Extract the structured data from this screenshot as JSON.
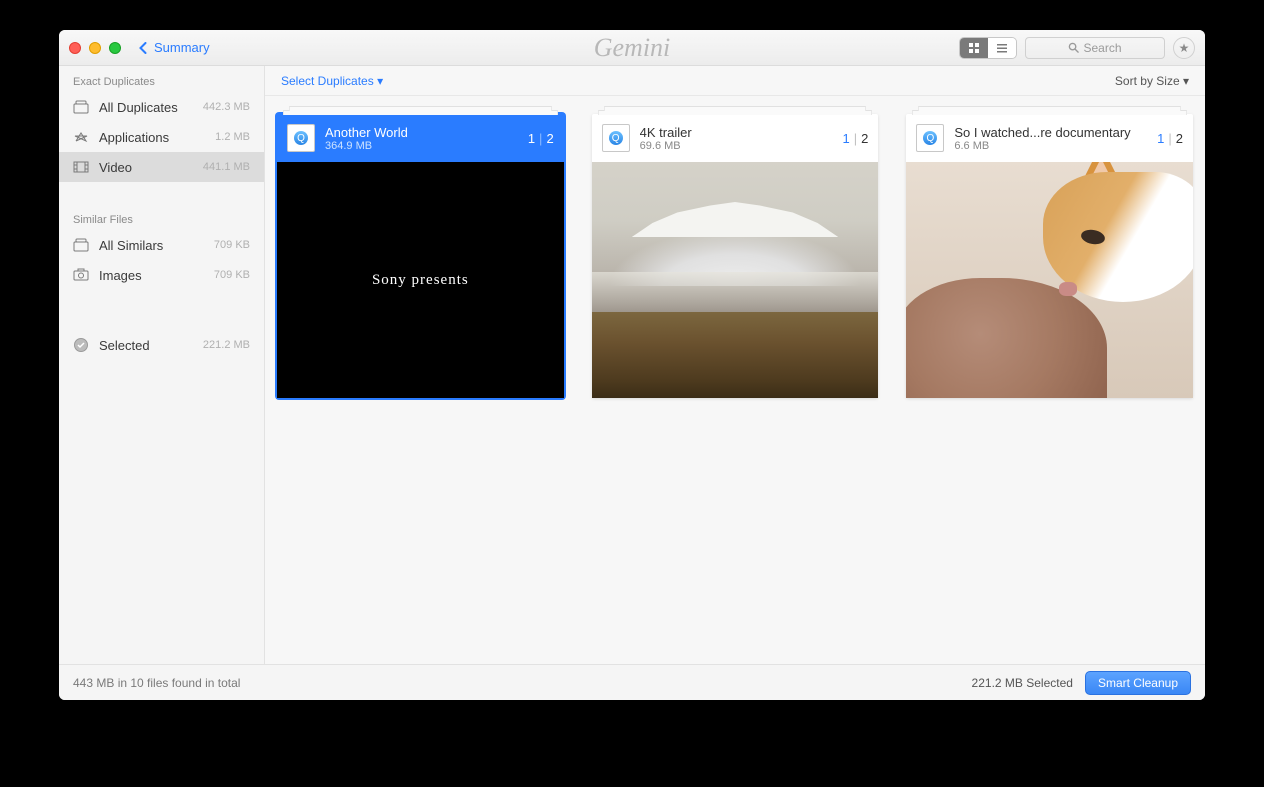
{
  "header": {
    "back_label": "Summary",
    "app_title": "Gemini",
    "search_placeholder": "Search"
  },
  "sidebar": {
    "sections": {
      "exact": {
        "title": "Exact Duplicates",
        "items": [
          {
            "label": "All Duplicates",
            "size": "442.3 MB"
          },
          {
            "label": "Applications",
            "size": "1.2 MB"
          },
          {
            "label": "Video",
            "size": "441.1 MB"
          }
        ]
      },
      "similar": {
        "title": "Similar Files",
        "items": [
          {
            "label": "All Similars",
            "size": "709 KB"
          },
          {
            "label": "Images",
            "size": "709 KB"
          }
        ]
      },
      "selected": {
        "label": "Selected",
        "size": "221.2 MB"
      }
    }
  },
  "main": {
    "select_duplicates": "Select Duplicates",
    "sort_label": "Sort by Size",
    "cards": [
      {
        "title": "Another World",
        "size": "364.9 MB",
        "current": "1",
        "total": "2",
        "thumb_text": "Sony presents"
      },
      {
        "title": "4K trailer",
        "size": "69.6 MB",
        "current": "1",
        "total": "2"
      },
      {
        "title": "So I watched...re documentary",
        "size": "6.6 MB",
        "current": "1",
        "total": "2"
      }
    ]
  },
  "footer": {
    "found": "443 MB in 10 files found in total",
    "selected": "221.2 MB Selected",
    "cleanup": "Smart Cleanup"
  }
}
